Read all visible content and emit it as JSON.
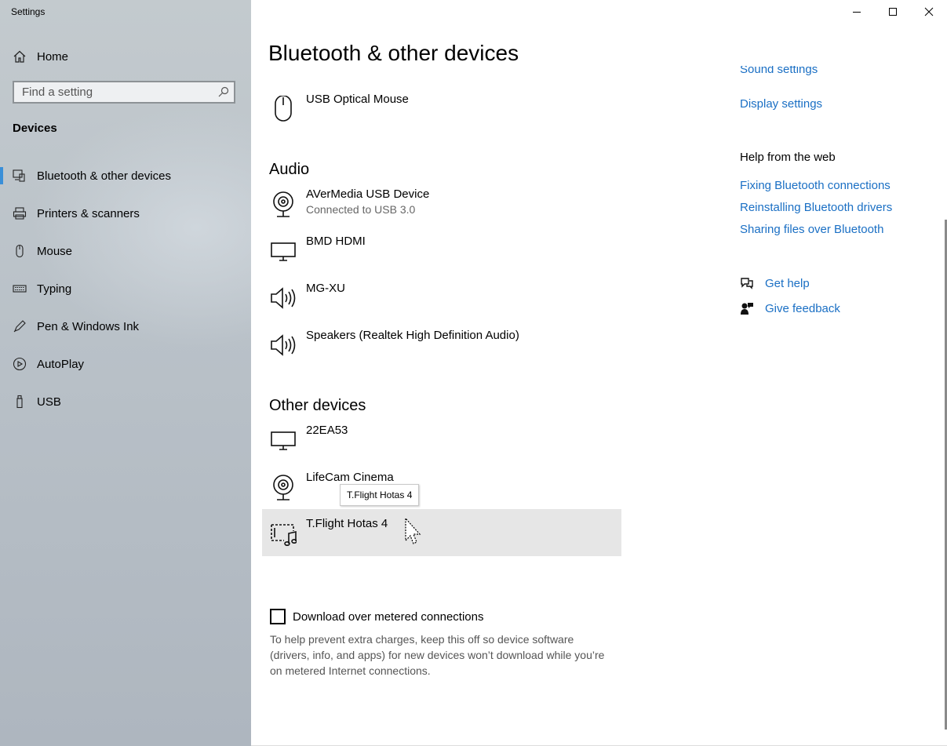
{
  "window": {
    "title": "Settings"
  },
  "sidebar": {
    "home_label": "Home",
    "search_placeholder": "Find a setting",
    "section": "Devices",
    "items": [
      {
        "label": "Bluetooth & other devices",
        "icon": "bluetooth-devices-icon",
        "active": true
      },
      {
        "label": "Printers & scanners",
        "icon": "printer-icon"
      },
      {
        "label": "Mouse",
        "icon": "mouse-icon"
      },
      {
        "label": "Typing",
        "icon": "keyboard-icon"
      },
      {
        "label": "Pen & Windows Ink",
        "icon": "pen-icon"
      },
      {
        "label": "AutoPlay",
        "icon": "autoplay-icon"
      },
      {
        "label": "USB",
        "icon": "usb-icon"
      }
    ]
  },
  "main": {
    "title": "Bluetooth & other devices",
    "mouse_device": {
      "name": "USB Optical Mouse",
      "icon": "mouse-icon"
    },
    "audio": {
      "heading": "Audio",
      "devices": [
        {
          "name": "AVerMedia USB Device",
          "status": "Connected to USB 3.0",
          "icon": "webcam-icon"
        },
        {
          "name": "BMD HDMI",
          "icon": "monitor-icon"
        },
        {
          "name": "MG-XU",
          "icon": "speaker-icon"
        },
        {
          "name": "Speakers (Realtek High Definition Audio)",
          "icon": "speaker-icon"
        }
      ]
    },
    "other": {
      "heading": "Other devices",
      "devices": [
        {
          "name": "22EA53",
          "icon": "monitor-icon"
        },
        {
          "name": "LifeCam Cinema",
          "icon": "webcam-icon"
        },
        {
          "name": "T.Flight Hotas 4",
          "icon": "multimedia-device-icon"
        }
      ]
    },
    "tooltip": "T.Flight Hotas 4",
    "metered": {
      "label": "Download over metered connections",
      "checked": false,
      "description": "To help prevent extra charges, keep this off so device software (drivers, info, and apps) for new devices won’t download while you’re on metered Internet connections."
    }
  },
  "related": {
    "sound_settings": "Sound settings",
    "display_settings": "Display settings"
  },
  "help": {
    "heading": "Help from the web",
    "links": [
      "Fixing Bluetooth connections",
      "Reinstalling Bluetooth drivers",
      "Sharing files over Bluetooth"
    ],
    "get_help": "Get help",
    "give_feedback": "Give feedback"
  },
  "colors": {
    "accent": "#1a6fc4",
    "active_indicator": "#3a8fd8",
    "hover_row": "#e6e6e6"
  }
}
